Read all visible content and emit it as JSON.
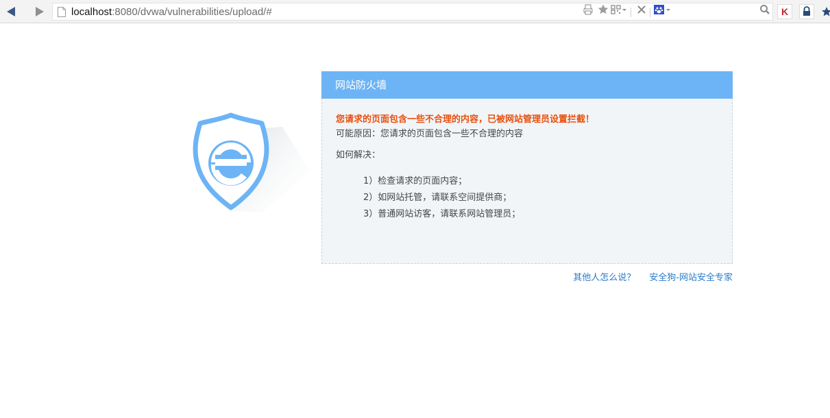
{
  "browser": {
    "url_host": "localhost",
    "url_rest": ":8080/dvwa/vulnerabilities/upload/#",
    "icons": [
      "back-arrow-icon",
      "forward-arrow-icon",
      "page-icon",
      "printer-icon",
      "star-icon",
      "qr-code-icon",
      "close-icon",
      "baidu-paw-icon",
      "search-icon"
    ],
    "extensions": {
      "k_label": "K"
    }
  },
  "firewall": {
    "title": "网站防火墙",
    "warning": "您请求的页面包含一些不合理的内容，已被网站管理员设置拦截！",
    "reason": "可能原因：您请求的页面包含一些不合理的内容",
    "how_to_solve": "如何解决：",
    "steps": [
      "1）检查请求的页面内容；",
      "2）如网站托管，请联系空间提供商；",
      "3）普通网站访客，请联系网站管理员；"
    ]
  },
  "footer": {
    "link_others": "其他人怎么说？",
    "link_brand": "安全狗-网站安全专家"
  },
  "colors": {
    "header_blue": "#6cb4f5",
    "warning_orange": "#e8500e",
    "link_blue": "#2a7ac9",
    "panel_bg": "#f2f5f8"
  }
}
